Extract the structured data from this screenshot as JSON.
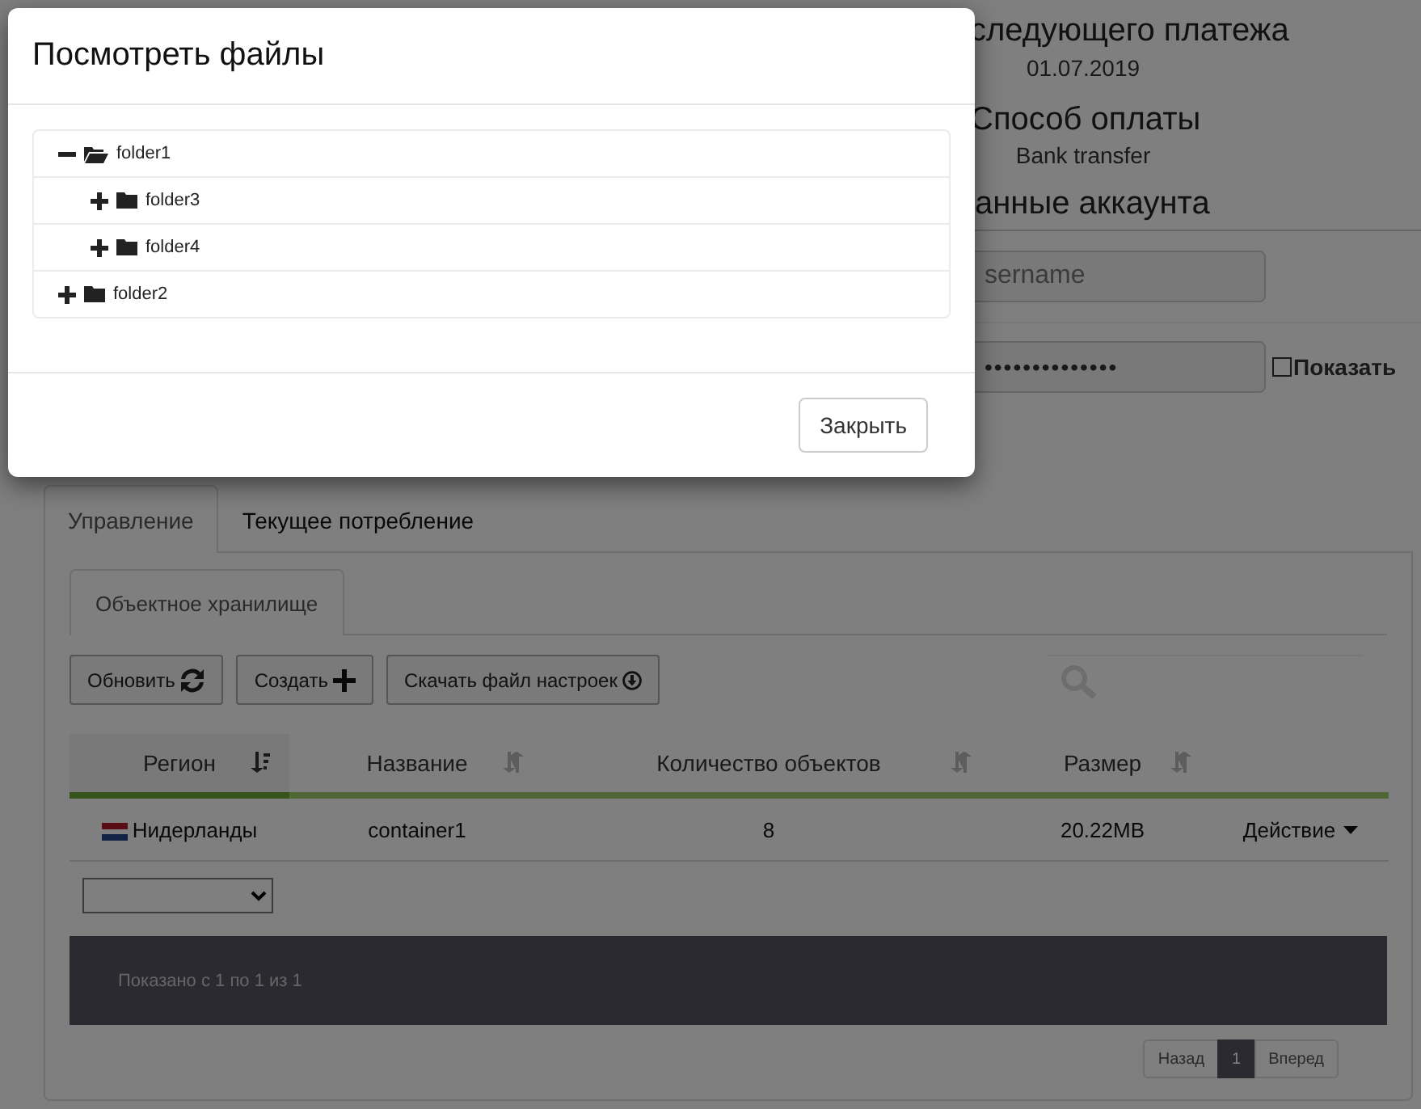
{
  "account": {
    "next_payment_heading": "следующего платежа",
    "next_payment_date": "01.07.2019",
    "payment_method_heading": "Способ оплаты",
    "payment_method": "Bank transfer",
    "account_heading": "анные аккаунта",
    "username_placeholder": "sername",
    "password_value": "••••••••••••••",
    "show_password": {
      "label": "Показать",
      "checked": false
    }
  },
  "tabs": [
    {
      "label": "Управление",
      "selected": true
    },
    {
      "label": "Текущее потребление",
      "selected": false
    }
  ],
  "subtabs": [
    {
      "label": "Объектное хранилище",
      "selected": true
    }
  ],
  "toolbar": [
    {
      "label": "Обновить",
      "kind": "refresh"
    },
    {
      "label": "Создать",
      "kind": "create"
    },
    {
      "label": "Скачать файл настроек",
      "kind": "download"
    }
  ],
  "table": {
    "columns": [
      {
        "label": "Регион",
        "sorted": true
      },
      {
        "label": "Название",
        "sorted": false
      },
      {
        "label": "Количество объектов",
        "sorted": false
      },
      {
        "label": "Размер",
        "sorted": false
      }
    ],
    "rows": [
      {
        "region": "Нидерланды",
        "name": "container1",
        "objects": "8",
        "size": "20.22MB",
        "action": "Действие"
      }
    ]
  },
  "footer_info": "Показано с 1 по 1 из 1",
  "pagination": [
    {
      "label": "Назад",
      "selected": false
    },
    {
      "label": "1",
      "selected": true
    },
    {
      "label": "Вперед",
      "selected": false
    }
  ],
  "modal": {
    "title": "Посмотреть файлы",
    "tree": [
      {
        "label": "folder1",
        "expanded": true,
        "children": [
          {
            "label": "folder3",
            "expanded": false
          },
          {
            "label": "folder4",
            "expanded": false
          }
        ]
      },
      {
        "label": "folder2",
        "expanded": false
      }
    ],
    "close_button": "Закрыть"
  }
}
